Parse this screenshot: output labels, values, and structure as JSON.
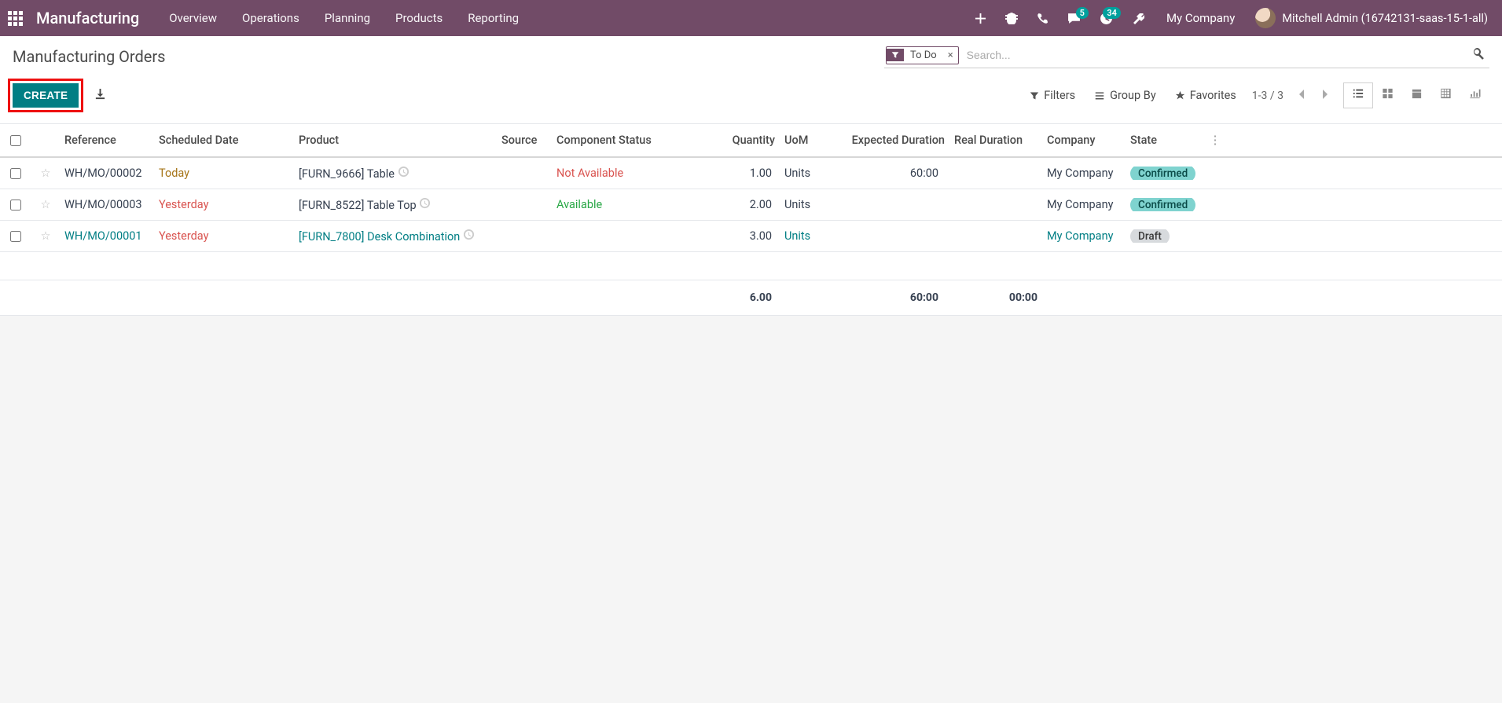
{
  "topbar": {
    "brand": "Manufacturing",
    "menu": [
      "Overview",
      "Operations",
      "Planning",
      "Products",
      "Reporting"
    ],
    "msg_badge": "5",
    "activity_badge": "34",
    "company": "My Company",
    "user": "Mitchell Admin (16742131-saas-15-1-all)"
  },
  "control": {
    "title": "Manufacturing Orders",
    "facet": "To Do",
    "search_placeholder": "Search...",
    "create": "CREATE",
    "filters": "Filters",
    "groupby": "Group By",
    "favorites": "Favorites",
    "pager": "1-3 / 3"
  },
  "columns": {
    "reference": "Reference",
    "scheduled": "Scheduled Date",
    "product": "Product",
    "source": "Source",
    "component": "Component Status",
    "quantity": "Quantity",
    "uom": "UoM",
    "expdur": "Expected Duration",
    "realdur": "Real Duration",
    "company": "Company",
    "state": "State"
  },
  "rows": [
    {
      "ref": "WH/MO/00002",
      "ref_link": false,
      "sched": "Today",
      "sched_cls": "today",
      "product": "[FURN_9666] Table",
      "prod_link": false,
      "comp": "Not Available",
      "comp_cls": "na",
      "qty": "1.00",
      "uom": "Units",
      "uom_link": false,
      "expdur": "60:00",
      "realdur": "",
      "company": "My Company",
      "company_link": false,
      "state": "Confirmed",
      "state_cls": ""
    },
    {
      "ref": "WH/MO/00003",
      "ref_link": false,
      "sched": "Yesterday",
      "sched_cls": "past",
      "product": "[FURN_8522] Table Top",
      "prod_link": false,
      "comp": "Available",
      "comp_cls": "av",
      "qty": "2.00",
      "uom": "Units",
      "uom_link": false,
      "expdur": "",
      "realdur": "",
      "company": "My Company",
      "company_link": false,
      "state": "Confirmed",
      "state_cls": ""
    },
    {
      "ref": "WH/MO/00001",
      "ref_link": true,
      "sched": "Yesterday",
      "sched_cls": "past",
      "product": "[FURN_7800] Desk Combination",
      "prod_link": true,
      "comp": "",
      "comp_cls": "",
      "qty": "3.00",
      "uom": "Units",
      "uom_link": true,
      "expdur": "",
      "realdur": "",
      "company": "My Company",
      "company_link": true,
      "state": "Draft",
      "state_cls": "draft"
    }
  ],
  "footer": {
    "qty": "6.00",
    "expdur": "60:00",
    "realdur": "00:00"
  }
}
